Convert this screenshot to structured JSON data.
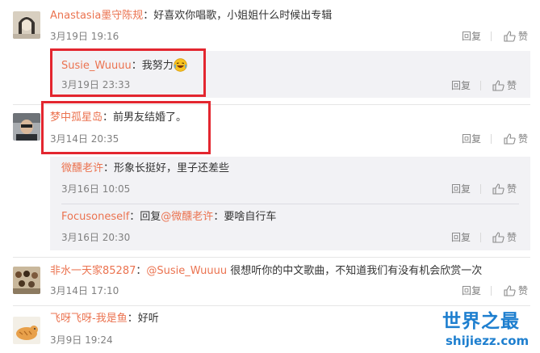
{
  "comments": [
    {
      "username": "Anastasia墨守陈规",
      "text": "：好喜欢你唱歌，小姐姐什么时候出专辑",
      "date": "3月19日 19:16",
      "reply_label": "回复",
      "like_label": "赞",
      "replies": [
        {
          "username": "Susie_Wuuuu",
          "text": "：我努力",
          "emoji": "laughing-crying-icon",
          "date": "3月19日 23:33",
          "reply_label": "回复",
          "like_label": "赞"
        }
      ]
    },
    {
      "username": "梦中孤星岛",
      "text": "：前男友结婚了。",
      "date": "3月14日 20:35",
      "reply_label": "回复",
      "like_label": "赞",
      "replies": [
        {
          "username": "微醺老许",
          "text": "：形象长挺好，里子还差些",
          "date": "3月16日 10:05",
          "reply_label": "回复",
          "like_label": "赞"
        },
        {
          "username": "Focusoneself",
          "text_pre": "：回复",
          "mention": "@微醺老许",
          "text": "：要啥自行车",
          "date": "3月16日 20:30",
          "reply_label": "回复",
          "like_label": "赞"
        }
      ]
    },
    {
      "username": "非水一天家85287",
      "text_pre": "：",
      "mention": "@Susie_Wuuuu",
      "text": " 很想听你的中文歌曲，不知道我们有没有机会欣赏一次",
      "date": "3月14日 17:10",
      "reply_label": "回复",
      "like_label": "赞"
    },
    {
      "username": "飞呀飞呀-我是鱼",
      "text": "：好听",
      "date": "3月9日 19:24"
    }
  ],
  "watermark": {
    "title": "世界之最",
    "domain": "shijiezz.com"
  },
  "colors": {
    "username": "#eb7350",
    "highlight_box": "#e3262f",
    "reply_bg": "#f2f2f5",
    "watermark": "#1e7fcf"
  }
}
